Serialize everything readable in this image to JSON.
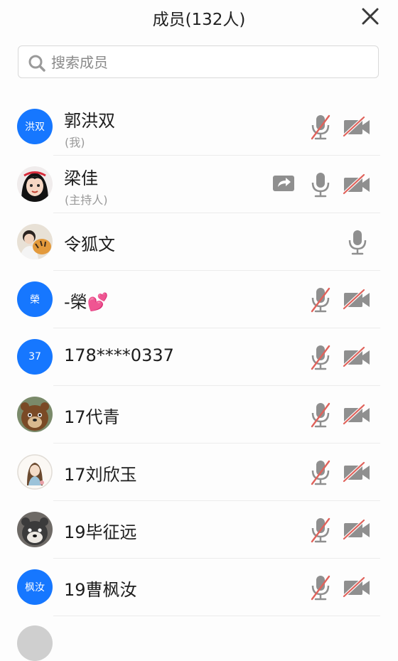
{
  "header": {
    "title": "成员(132人)"
  },
  "search": {
    "placeholder": "搜索成员"
  },
  "members": [
    {
      "name": "郭洪双",
      "role": "(我)",
      "avatar_text": "洪双",
      "avatar_color": "#1677ff",
      "mic": "muted",
      "camera": "off",
      "sharing": false
    },
    {
      "name": "梁佳",
      "role": "(主持人)",
      "avatar": "photo-cartoon-girl",
      "mic": "on",
      "camera": "off",
      "sharing": true
    },
    {
      "name": "令狐文",
      "role": "",
      "avatar": "photo-person-with-tiger",
      "mic": "on",
      "camera": "none",
      "sharing": false
    },
    {
      "name": "-榮💕",
      "role": "",
      "avatar_text": "榮",
      "avatar_color": "#1677ff",
      "mic": "muted",
      "camera": "off",
      "sharing": false
    },
    {
      "name": "178****0337",
      "role": "",
      "avatar_text": "37",
      "avatar_color": "#1677ff",
      "mic": "muted",
      "camera": "off",
      "sharing": false
    },
    {
      "name": "17代青",
      "role": "",
      "avatar": "photo-cartoon-bear",
      "mic": "muted",
      "camera": "off",
      "sharing": false
    },
    {
      "name": "17刘欣玉",
      "role": "",
      "avatar": "photo-illustration-girl",
      "mic": "muted",
      "camera": "off",
      "sharing": false
    },
    {
      "name": "19毕征远",
      "role": "",
      "avatar": "photo-cartoon-bears",
      "mic": "muted",
      "camera": "off",
      "sharing": false
    },
    {
      "name": "19曹枫汝",
      "role": "",
      "avatar_text": "枫汝",
      "avatar_color": "#1677ff",
      "mic": "muted",
      "camera": "off",
      "sharing": false
    }
  ],
  "icons": {
    "close": "close-icon",
    "search": "search-icon",
    "mic": "microphone-icon",
    "mic_muted": "microphone-muted-icon",
    "camera_off": "video-off-icon",
    "screen_share": "screen-share-icon"
  },
  "colors": {
    "accent": "#1677ff",
    "muted_slash": "#e0625b",
    "icon_gray": "#8f8f8f"
  }
}
